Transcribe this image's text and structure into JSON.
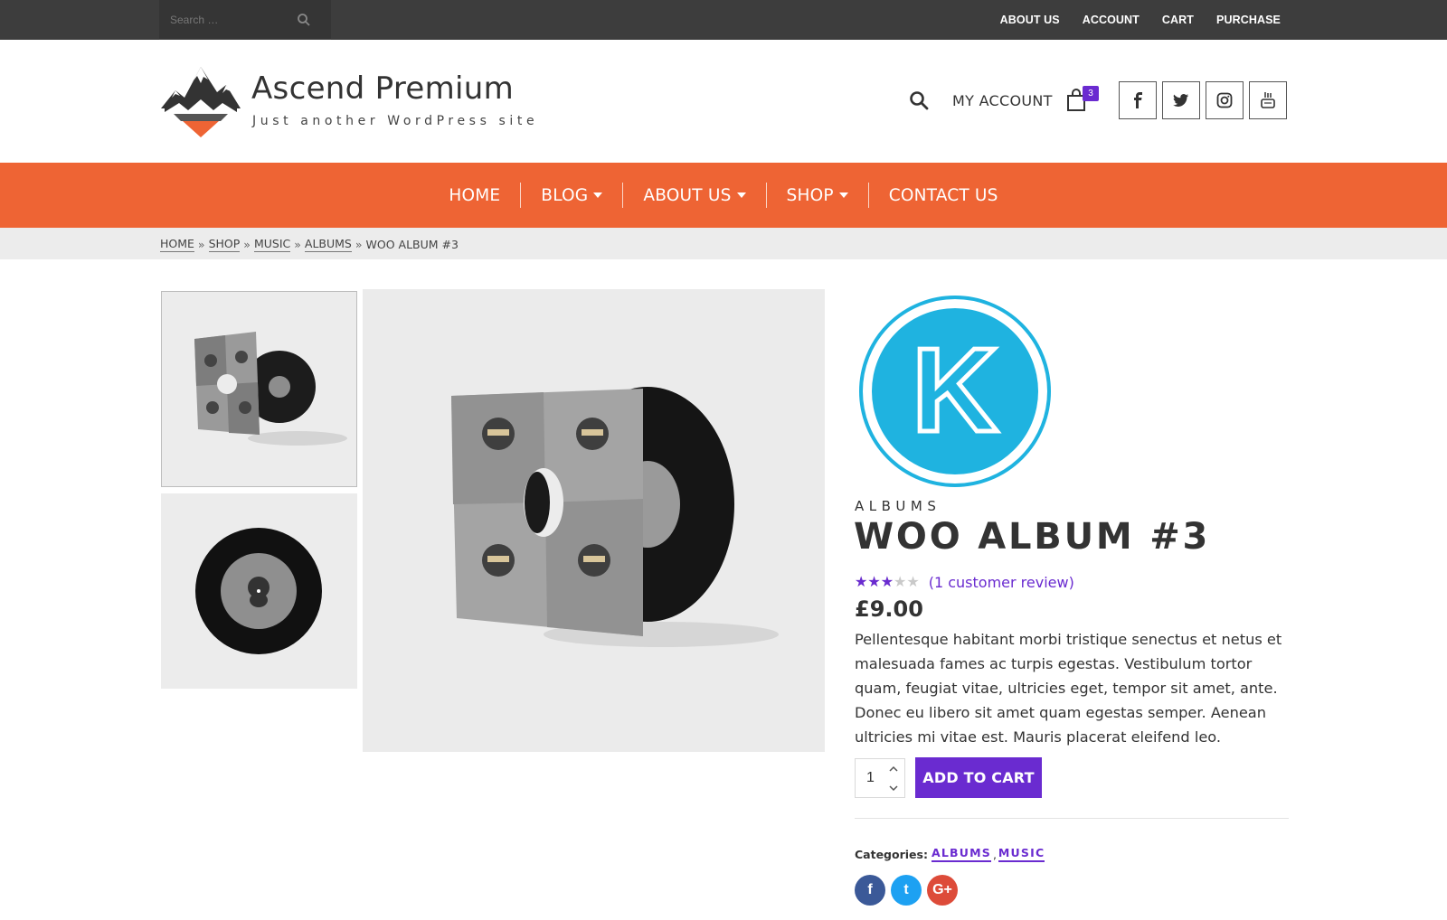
{
  "topbar": {
    "search_placeholder": "Search …",
    "links": [
      "ABOUT US",
      "ACCOUNT",
      "CART",
      "PURCHASE"
    ]
  },
  "header": {
    "site_title": "Ascend Premium",
    "tagline": "Just another WordPress site",
    "my_account": "MY ACCOUNT",
    "cart_count": "3",
    "socials": [
      "facebook-icon",
      "twitter-icon",
      "instagram-icon",
      "youtube-icon"
    ]
  },
  "nav": {
    "items": [
      {
        "label": "HOME",
        "dropdown": false
      },
      {
        "label": "BLOG",
        "dropdown": true
      },
      {
        "label": "ABOUT US",
        "dropdown": true
      },
      {
        "label": "SHOP",
        "dropdown": true
      },
      {
        "label": "CONTACT US",
        "dropdown": false
      }
    ]
  },
  "breadcrumb": {
    "links": [
      "HOME",
      "SHOP",
      "MUSIC",
      "ALBUMS"
    ],
    "separator": "»",
    "current": "WOO ALBUM #3"
  },
  "product": {
    "brand_letter": "K",
    "category": "ALBUMS",
    "title": "WOO ALBUM #3",
    "rating": 3,
    "rating_max": 5,
    "review_text": "(1 customer review)",
    "price": "£9.00",
    "description": "Pellentesque habitant morbi tristique senectus et netus et malesuada fames ac turpis egestas. Vestibulum tortor quam, feugiat vitae, ultricies eget, tempor sit amet, ante. Donec eu libero sit amet quam egestas semper. Aenean ultricies mi vitae est. Mauris placerat eleifend leo.",
    "quantity": "1",
    "add_to_cart": "ADD TO CART",
    "categories_label": "Categories:",
    "categories": [
      "ALBUMS",
      "MUSIC"
    ],
    "categories_sep": ",",
    "share": [
      {
        "icon": "facebook-icon",
        "glyph": "f",
        "color": "#3b5998"
      },
      {
        "icon": "twitter-icon",
        "glyph": "t",
        "color": "#1da1f2"
      },
      {
        "icon": "googleplus-icon",
        "glyph": "G+",
        "color": "#dd4b39"
      }
    ]
  },
  "colors": {
    "accent": "#ee6434",
    "purple": "#6a2bd0",
    "topbar": "#3d3d3d",
    "brand_circle": "#1fb3e0"
  }
}
